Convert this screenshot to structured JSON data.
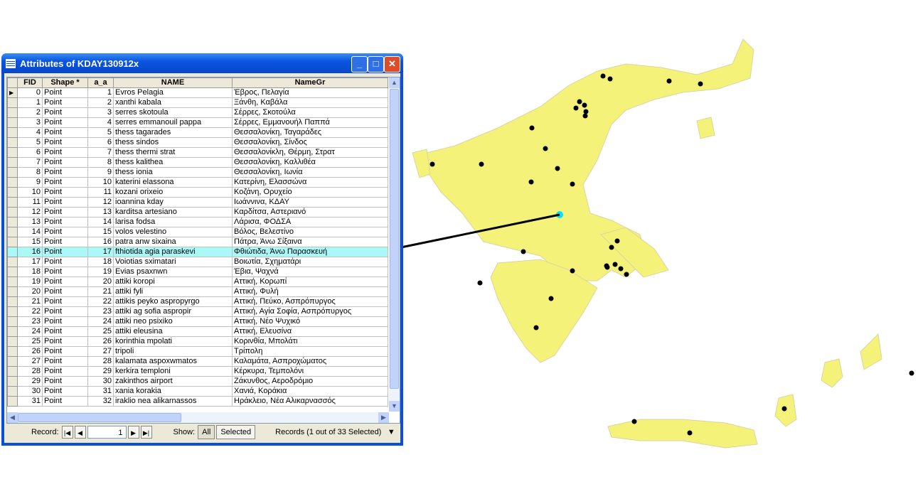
{
  "window": {
    "title": "Attributes of KDAY130912x",
    "minimize": "_",
    "maximize": "□",
    "close": "✕"
  },
  "table": {
    "columns": [
      "FID",
      "Shape *",
      "a_a",
      "NAME",
      "NameGr"
    ],
    "rows": [
      [
        0,
        "Point",
        1,
        "Evros Pelagia",
        "Έβρος, Πελαγία"
      ],
      [
        1,
        "Point",
        2,
        "xanthi kabala",
        "Ξάνθη, Καβάλα"
      ],
      [
        2,
        "Point",
        3,
        "serres skotoula",
        "Σέρρες, Σκοτούλα"
      ],
      [
        3,
        "Point",
        4,
        "serres emmanouil pappa",
        "Σέρρες, Εμμανουήλ Παππά"
      ],
      [
        4,
        "Point",
        5,
        "thess tagarades",
        "Θεσσαλονίκη, Ταγαράδες"
      ],
      [
        5,
        "Point",
        6,
        "thess sindos",
        "Θεσσαλονίκη, Σίνδος"
      ],
      [
        6,
        "Point",
        7,
        "thess thermi strat",
        "Θεσσαλονίκλη, Θέρμη, Στρατ"
      ],
      [
        7,
        "Point",
        8,
        "thess kalithea",
        "Θεσσαλονίκη, Καλλιθέα"
      ],
      [
        8,
        "Point",
        9,
        "thess ionia",
        "Θεσσαλονίκη, Ιωνία"
      ],
      [
        9,
        "Point",
        10,
        "katerini elassona",
        "Κατερίνη, Ελασσώνα"
      ],
      [
        10,
        "Point",
        11,
        "kozani orixeio",
        "Κοζάνη, Ορυχείο"
      ],
      [
        11,
        "Point",
        12,
        "ioannina kday",
        "Ιωάννινα, ΚΔΑΥ"
      ],
      [
        12,
        "Point",
        13,
        "karditsa artesiano",
        "Καρδίτσα, Αστεριανό"
      ],
      [
        13,
        "Point",
        14,
        "larisa fodsa",
        "Λάρισα, ΦΟΔΣΑ"
      ],
      [
        14,
        "Point",
        15,
        "volos velestino",
        "Βόλος, Βελεστίνο"
      ],
      [
        15,
        "Point",
        16,
        "patra anw sixaina",
        "Πάτρα, Άνω Σίξαινα"
      ],
      [
        16,
        "Point",
        17,
        "fthiotida agia paraskevi",
        "Φθιώτιδα, Άνω Παρασκευή"
      ],
      [
        17,
        "Point",
        18,
        "Voiotias sximatari",
        "Βοιωτία, Σχηματάρι"
      ],
      [
        18,
        "Point",
        19,
        "Evias psaxnwn",
        "Έβια, Ψαχνά"
      ],
      [
        19,
        "Point",
        20,
        "attiki koropi",
        "Αττική, Κορωπί"
      ],
      [
        20,
        "Point",
        21,
        "attiki fyli",
        "Αττική, Φυλή"
      ],
      [
        21,
        "Point",
        22,
        "attikis peyko aspropyrgo",
        "Αττική, Πεύκο, Ασπρόπυργος"
      ],
      [
        22,
        "Point",
        23,
        "attiki ag sofia aspropir",
        "Αττική, Αγία Σοφία, Ασπρόπυργος"
      ],
      [
        23,
        "Point",
        24,
        "attiki neo psixiko",
        "Αττική, Νέο Ψυχικό"
      ],
      [
        24,
        "Point",
        25,
        "attiki eleusina",
        "Αττική, Ελευσίνα"
      ],
      [
        25,
        "Point",
        26,
        "korinthia mpolati",
        "Κορινθία, Μπολάτι"
      ],
      [
        26,
        "Point",
        27,
        "tripoli",
        "Τρίπολη"
      ],
      [
        27,
        "Point",
        28,
        "kalamata aspoxwmatos",
        "Καλαμάτα, Ασπροχώματος"
      ],
      [
        28,
        "Point",
        29,
        "kerkira temploni",
        "Κέρκυρα, Τεμπολόνι"
      ],
      [
        29,
        "Point",
        30,
        "zakinthos airport",
        "Ζάκυνθος, Αεροδρόμιο"
      ],
      [
        30,
        "Point",
        31,
        "xania korakia",
        "Χανιά, Κοράκια"
      ],
      [
        31,
        "Point",
        32,
        "iraklio nea alikarnassos",
        "Ηράκλειο, Νέα Αλικαρνασσός"
      ]
    ],
    "selected_fid": 16
  },
  "footer": {
    "record_label": "Record:",
    "record_value": "1",
    "show_label": "Show:",
    "all": "All",
    "selected": "Selected",
    "records_status": "Records (1 out of 33 Selected)"
  },
  "colors": {
    "land": "#f5f27a",
    "highlight": "#aaf8f8",
    "point": "#000000",
    "selected_point": "#00e5ff"
  }
}
